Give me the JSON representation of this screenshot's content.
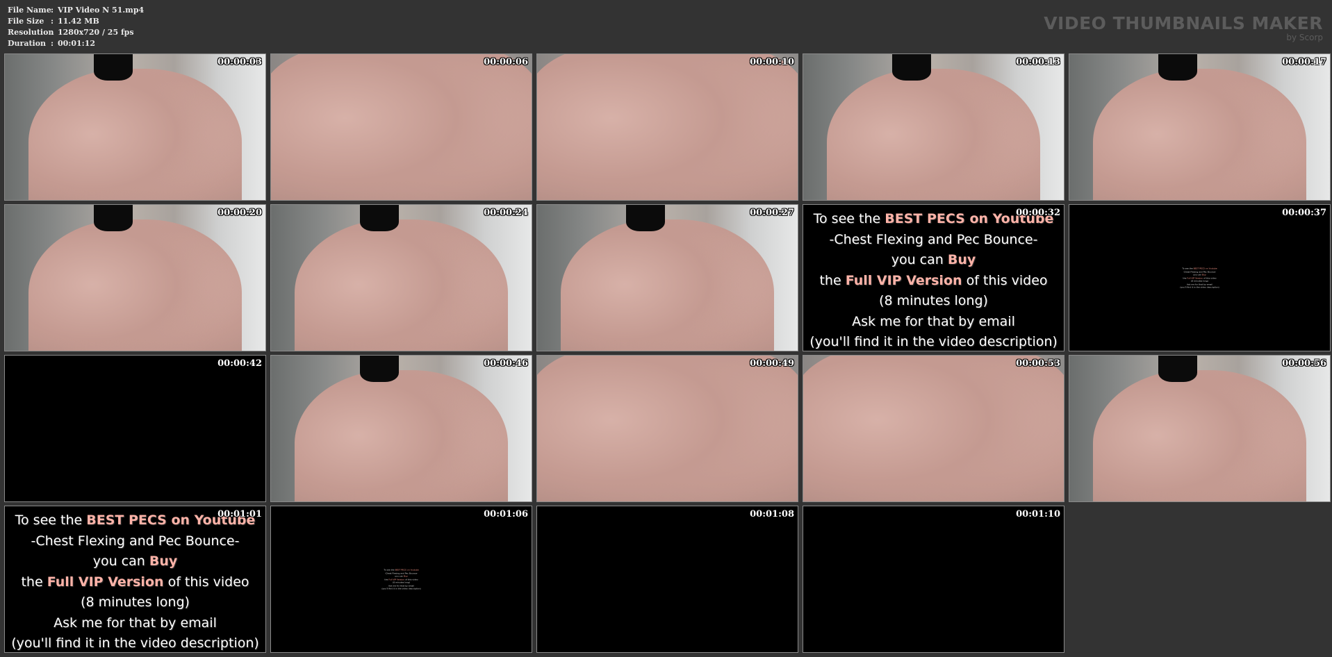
{
  "file_info": [
    {
      "key": "File Name",
      "value": "VIP Video N 51.mp4"
    },
    {
      "key": "File Size",
      "value": "11.42 MB"
    },
    {
      "key": "Resolution",
      "value": "1280x720 / 25 fps"
    },
    {
      "key": "Duration",
      "value": "00:01:12"
    }
  ],
  "separator": ":",
  "brand": {
    "title": "VIDEO THUMBNAILS MAKER",
    "subtitle": "by Scorp"
  },
  "promo": {
    "l1_a": "To see the ",
    "l1_hl": "BEST PECS on Youtube",
    "l2": "-Chest Flexing and Pec Bounce-",
    "l3_a": "you can ",
    "l3_hl": "Buy",
    "l4_a": "the ",
    "l4_hl": "Full VIP Version",
    "l4_b": " of this video",
    "l5": "(8 minutes long)",
    "l6": "Ask me for that by email",
    "l7": "(you'll find it in the video description)"
  },
  "thumbnails": [
    {
      "time": "00:00:03",
      "kind": "body"
    },
    {
      "time": "00:00:06",
      "kind": "close"
    },
    {
      "time": "00:00:10",
      "kind": "close"
    },
    {
      "time": "00:00:13",
      "kind": "body"
    },
    {
      "time": "00:00:17",
      "kind": "body"
    },
    {
      "time": "00:00:20",
      "kind": "body"
    },
    {
      "time": "00:00:24",
      "kind": "body"
    },
    {
      "time": "00:00:27",
      "kind": "body"
    },
    {
      "time": "00:00:32",
      "kind": "promo"
    },
    {
      "time": "00:00:37",
      "kind": "promo-tiny"
    },
    {
      "time": "00:00:42",
      "kind": "black"
    },
    {
      "time": "00:00:46",
      "kind": "body"
    },
    {
      "time": "00:00:49",
      "kind": "close"
    },
    {
      "time": "00:00:53",
      "kind": "close"
    },
    {
      "time": "00:00:56",
      "kind": "body"
    },
    {
      "time": "00:01:01",
      "kind": "promo"
    },
    {
      "time": "00:01:06",
      "kind": "promo-tiny"
    },
    {
      "time": "00:01:08",
      "kind": "black"
    },
    {
      "time": "00:01:10",
      "kind": "black"
    }
  ]
}
